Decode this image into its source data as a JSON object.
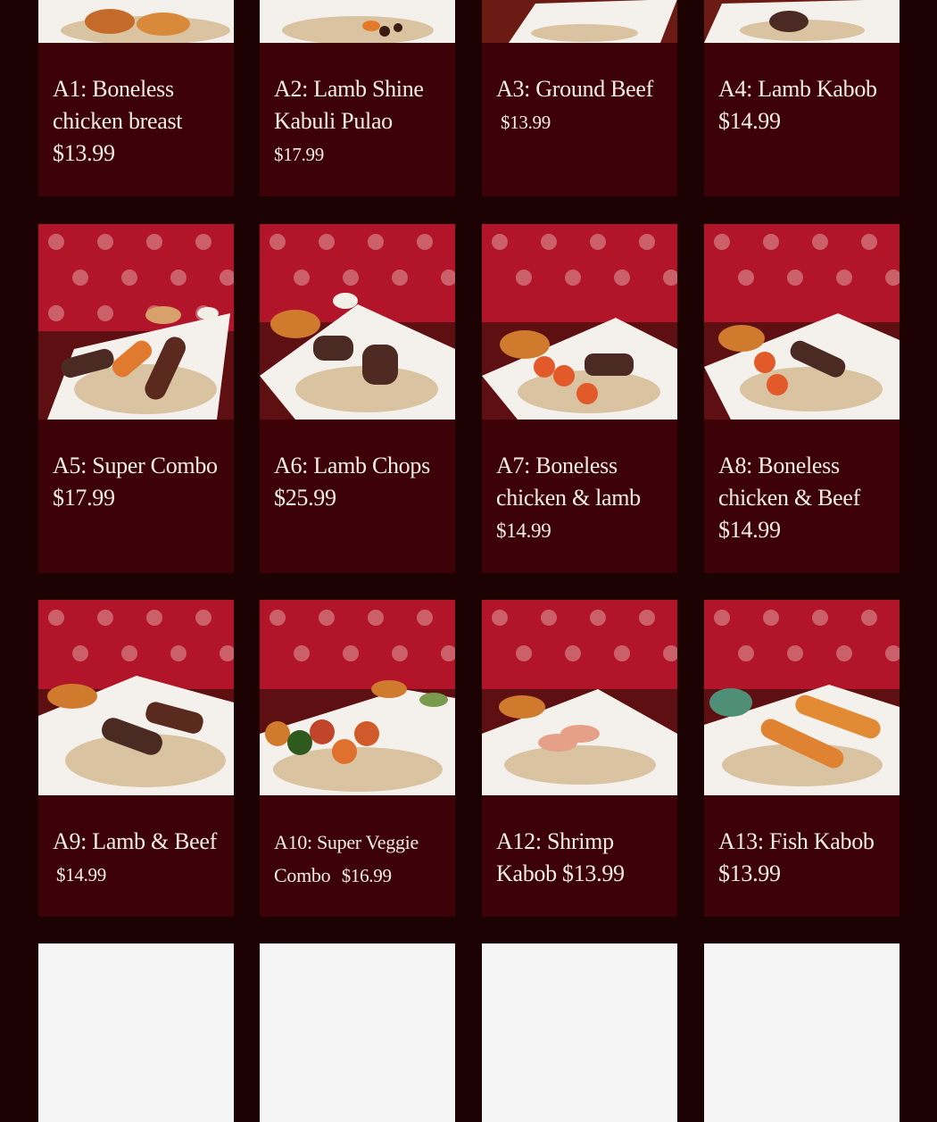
{
  "menu": {
    "row1": [
      {
        "title": "A1: Boneless chicken breast",
        "price": "$13.99"
      },
      {
        "title": "A2:  Lamb Shine Kabuli Pulao",
        "price": "$17.99"
      },
      {
        "title": "A3:  Ground Beef",
        "price": "$13.99"
      },
      {
        "title": "A4:  Lamb Kabob",
        "price": "$14.99"
      }
    ],
    "row2": [
      {
        "title": "A5:  Super Combo",
        "price": "$17.99"
      },
      {
        "title": "A6:  Lamb Chops",
        "price": "$25.99"
      },
      {
        "title": "A7: Boneless chicken & lamb",
        "price": "$14.99"
      },
      {
        "title": "A8: Boneless chicken & Beef",
        "price": "$14.99"
      }
    ],
    "row3": [
      {
        "title": "A9: Lamb & Beef",
        "price": "$14.99"
      },
      {
        "title": "A10:  Super  Veggie Combo",
        "price": "$16.99"
      },
      {
        "title": "A12:  Shrimp Kabob",
        "price": "$13.99"
      },
      {
        "title": "A13:  Fish Kabob",
        "price": "$13.99"
      }
    ]
  },
  "colors": {
    "page_background": "#1d0204",
    "card_background": "#3d0207",
    "text": "#f3ede4",
    "rug_red": "#b2142a",
    "placeholder": "#f5f5f5"
  },
  "icons": {
    "food_photo": "plate-of-kabob-and-rice-on-red-rug"
  }
}
